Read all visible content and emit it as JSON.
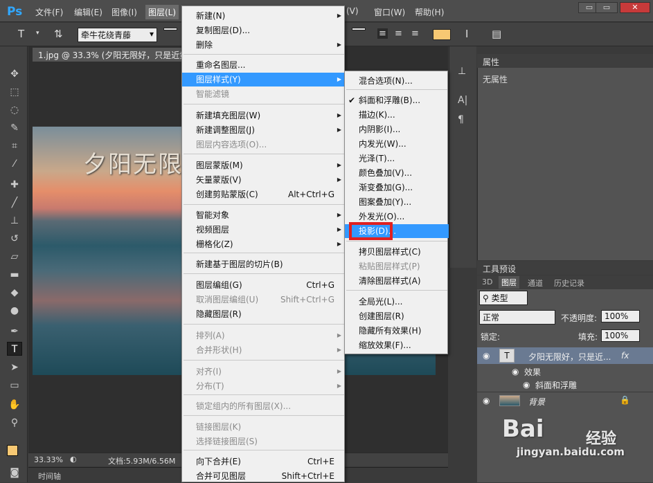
{
  "app": {
    "logo": "Ps"
  },
  "menubar": {
    "items": [
      "文件(F)",
      "编辑(E)",
      "图像(I)",
      "图层(L)",
      "(V)",
      "窗口(W)",
      "帮助(H)"
    ],
    "window_buttons": [
      "▭",
      "▭",
      "✕"
    ]
  },
  "options": {
    "font_family": "牵牛花绕青藤",
    "font_dropdown": "▾",
    "small_dropdown": "▾",
    "color_swatch": "#f7c873"
  },
  "document": {
    "tab_title": "1.jpg @ 33.3% (夕阳无限好，只是近黄",
    "canvas_text": "夕阳无限",
    "zoom": "33.33%",
    "doc_size": "文档:5.93M/6.56M",
    "timeline": "时间轴"
  },
  "panels": {
    "properties_title": "属性",
    "no_properties": "无属性",
    "tool_presets_title": "工具预设",
    "layers_tabs": [
      "3D",
      "图层",
      "通道",
      "历史记录"
    ],
    "filter_kind": "类型",
    "blend_mode": "正常",
    "opacity_label": "不透明度:",
    "opacity_value": "100%",
    "lock_label": "锁定:",
    "fill_label": "填充:",
    "fill_value": "100%",
    "layers": [
      {
        "name": "夕阳无限好，只是近...",
        "fx": "fx"
      },
      {
        "name": "效果"
      },
      {
        "name": "斜面和浮雕"
      },
      {
        "name": "背景"
      }
    ]
  },
  "layer_menu": {
    "items": [
      {
        "label": "新建(N)",
        "arrow": true
      },
      {
        "label": "复制图层(D)..."
      },
      {
        "label": "删除",
        "arrow": true
      },
      {
        "label": "重命名图层..."
      },
      {
        "label": "图层样式(Y)",
        "arrow": true,
        "highlight": true
      },
      {
        "label": "智能滤镜",
        "disabled": true
      },
      {
        "label": "新建填充图层(W)",
        "arrow": true
      },
      {
        "label": "新建调整图层(J)",
        "arrow": true
      },
      {
        "label": "图层内容选项(O)...",
        "disabled": true
      },
      {
        "label": "图层蒙版(M)",
        "arrow": true
      },
      {
        "label": "矢量蒙版(V)",
        "arrow": true
      },
      {
        "label": "创建剪贴蒙版(C)",
        "shortcut": "Alt+Ctrl+G"
      },
      {
        "label": "智能对象",
        "arrow": true
      },
      {
        "label": "视频图层",
        "arrow": true
      },
      {
        "label": "栅格化(Z)",
        "arrow": true
      },
      {
        "label": "新建基于图层的切片(B)"
      },
      {
        "label": "图层编组(G)",
        "shortcut": "Ctrl+G"
      },
      {
        "label": "取消图层编组(U)",
        "shortcut": "Shift+Ctrl+G",
        "disabled": true
      },
      {
        "label": "隐藏图层(R)"
      },
      {
        "label": "排列(A)",
        "arrow": true,
        "disabled": true
      },
      {
        "label": "合并形状(H)",
        "arrow": true,
        "disabled": true
      },
      {
        "label": "对齐(I)",
        "arrow": true,
        "disabled": true
      },
      {
        "label": "分布(T)",
        "arrow": true,
        "disabled": true
      },
      {
        "label": "锁定组内的所有图层(X)...",
        "disabled": true
      },
      {
        "label": "链接图层(K)",
        "disabled": true
      },
      {
        "label": "选择链接图层(S)",
        "disabled": true
      },
      {
        "label": "向下合并(E)",
        "shortcut": "Ctrl+E"
      },
      {
        "label": "合并可见图层",
        "shortcut": "Shift+Ctrl+E"
      }
    ]
  },
  "style_menu": {
    "items": [
      {
        "label": "混合选项(N)..."
      },
      {
        "label": "斜面和浮雕(B)...",
        "checked": true
      },
      {
        "label": "描边(K)..."
      },
      {
        "label": "内阴影(I)..."
      },
      {
        "label": "内发光(W)..."
      },
      {
        "label": "光泽(T)..."
      },
      {
        "label": "颜色叠加(V)..."
      },
      {
        "label": "渐变叠加(G)..."
      },
      {
        "label": "图案叠加(Y)..."
      },
      {
        "label": "外发光(O)..."
      },
      {
        "label": "投影(D)...",
        "highlight": true
      },
      {
        "label": "拷贝图层样式(C)"
      },
      {
        "label": "粘贴图层样式(P)",
        "disabled": true
      },
      {
        "label": "清除图层样式(A)"
      },
      {
        "label": "全局光(L)..."
      },
      {
        "label": "创建图层(R)"
      },
      {
        "label": "隐藏所有效果(H)"
      },
      {
        "label": "缩放效果(F)..."
      }
    ],
    "check_glyph": "✔"
  },
  "watermark": {
    "brand": "Bai",
    "brand2": "经验",
    "url": "jingyan.baidu.com"
  },
  "icons": {
    "arrow_right": "▶"
  }
}
